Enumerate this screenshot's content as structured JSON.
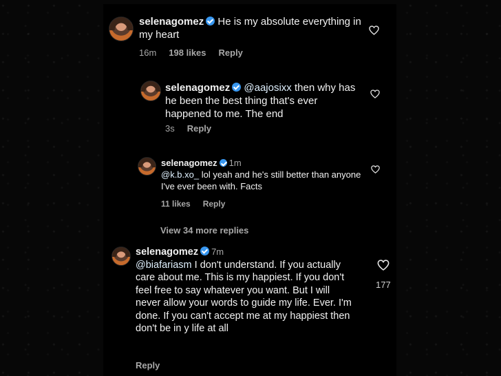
{
  "comments": [
    {
      "username": "selenagomez",
      "time": "",
      "mention": "",
      "body": "He is my absolute everything in my heart",
      "meta_time": "16m",
      "meta_likes": "198 likes",
      "meta_reply": "Reply"
    },
    {
      "username": "selenagomez",
      "time": "",
      "mention": "@aajosixx",
      "body": " then why has he been the best thing that's ever happened to me. The end",
      "meta_time": "3s",
      "meta_reply": "Reply"
    },
    {
      "username": "selenagomez",
      "time": "1m",
      "mention": "@k.b.xo_",
      "body": " lol yeah and he's still better than anyone I've ever been with. Facts",
      "meta_likes": "11 likes",
      "meta_reply": "Reply"
    },
    {
      "username": "selenagomez",
      "time": "7m",
      "mention": "@biafariasm",
      "body": " I don't understand. If you actually care about me. This is my happiest. If you don't feel free to say whatever you want. But I will never allow your words to guide my life. Ever. I'm done. If you can't accept me at my happiest then don't be in y life at all",
      "meta_reply": "Reply",
      "like_count": "177"
    }
  ],
  "view_more": "View 34 more replies",
  "icons": {
    "heart": "heart-outline-icon",
    "verified": "verified-badge-icon"
  },
  "colors": {
    "background": "#000000",
    "text": "#f2f2f2",
    "muted": "#a8a8a8",
    "verified": "#3897f0"
  }
}
